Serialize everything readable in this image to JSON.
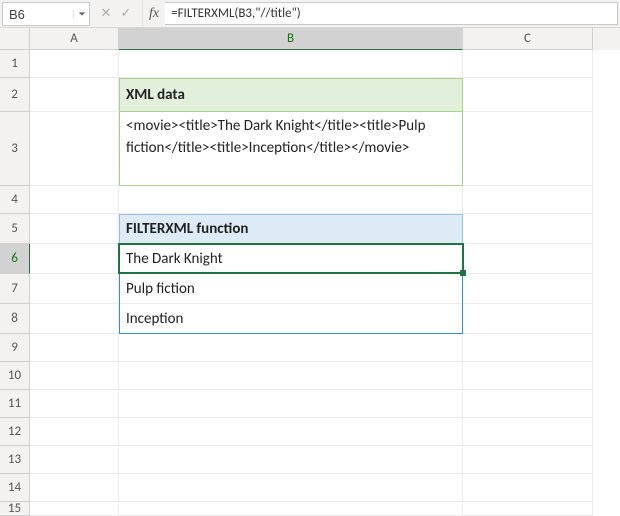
{
  "namebox": {
    "value": "B6"
  },
  "formula_bar": {
    "value": "=FILTERXML(B3,\"//title\")"
  },
  "columns": [
    "A",
    "B",
    "C"
  ],
  "row_numbers": [
    "1",
    "2",
    "3",
    "4",
    "5",
    "6",
    "7",
    "8",
    "9",
    "10",
    "11",
    "12",
    "13",
    "14",
    "15"
  ],
  "sections": {
    "xml_header": "XML data",
    "xml_body": "<movie><title>The Dark Knight</title><title>Pulp fiction</title><title>Inception</title></movie>",
    "func_header": "FILTERXML function",
    "results": [
      "The Dark Knight",
      "Pulp fiction",
      "Inception"
    ]
  },
  "active_cell": "B6",
  "selected_col": "B",
  "selected_row": "6",
  "icons": {
    "cancel": "✕",
    "confirm": "✓",
    "fx": "fx"
  }
}
